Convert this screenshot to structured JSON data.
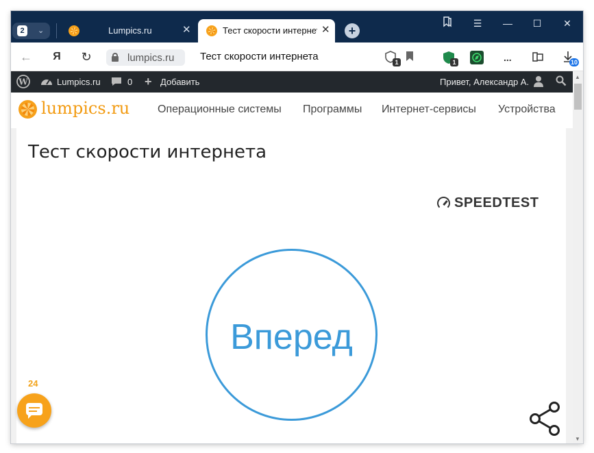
{
  "browser": {
    "tab_count": "2",
    "tabs": [
      {
        "title": "Lumpics.ru",
        "icon": "orange-favicon",
        "active": false
      },
      {
        "title": "Тест скорости интернета",
        "icon": "orange-favicon",
        "active": true
      }
    ],
    "url_host": "lumpics.ru",
    "page_title": "Тест скорости интернета",
    "extension_badges": {
      "shield": "1",
      "green": "1"
    },
    "more": "...",
    "downloads_badge": "10"
  },
  "wp_admin_bar": {
    "site": "Lumpics.ru",
    "comments": "0",
    "add": "Добавить",
    "greeting": "Привет, Александр А."
  },
  "site": {
    "name": "lumpics.ru",
    "menu": [
      "Операционные системы",
      "Программы",
      "Интернет-сервисы",
      "Устройства"
    ]
  },
  "content": {
    "title": "Тест скорости интернета",
    "speedtest_brand": "SPEEDTEST",
    "go_label": "Вперед",
    "chat_count": "24"
  },
  "colors": {
    "tabbar": "#0e2a4c",
    "accent_orange": "#f7a21b",
    "go_blue": "#3b9ad9",
    "wp_bar": "#23282d"
  }
}
